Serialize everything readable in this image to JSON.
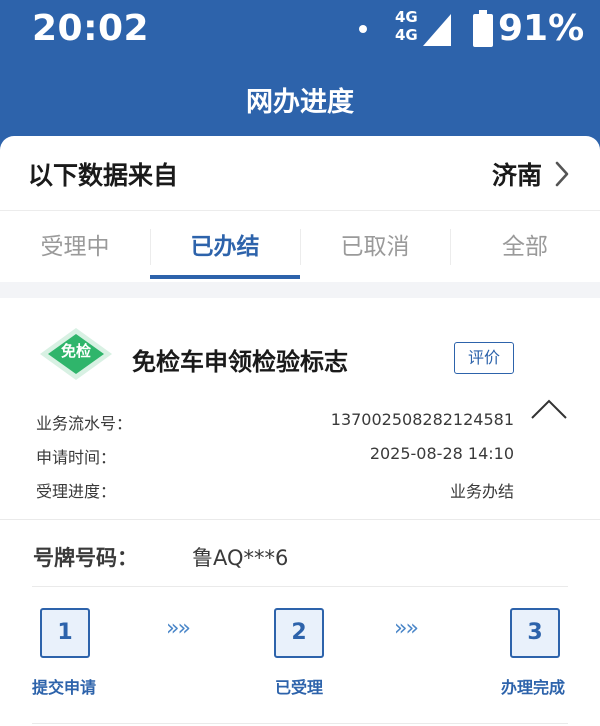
{
  "status_bar": {
    "time": "20:02",
    "network_top": "4G",
    "network_bottom": "4G",
    "battery": "91%"
  },
  "header": {
    "title": "网办进度"
  },
  "source": {
    "label": "以下数据来自",
    "city": "济南"
  },
  "tabs": [
    {
      "label": "受理中",
      "active": false
    },
    {
      "label": "已办结",
      "active": true
    },
    {
      "label": "已取消",
      "active": false
    },
    {
      "label": "全部",
      "active": false
    }
  ],
  "record": {
    "badge": "免检",
    "title": "免检车申领检验标志",
    "rate_label": "评价",
    "fields": [
      {
        "label": "业务流水号：",
        "value": "137002508282124581"
      },
      {
        "label": "申请时间：",
        "value": "2025-08-28 14:10"
      },
      {
        "label": "受理进度：",
        "value": "业务办结"
      }
    ],
    "plate_label": "号牌号码：",
    "plate_value": "鲁AQ***6",
    "steps": [
      {
        "number": "1",
        "label": "提交申请"
      },
      {
        "number": "2",
        "label": "已受理"
      },
      {
        "number": "3",
        "label": "办理完成"
      }
    ],
    "arrow_glyph": "»»"
  },
  "colors": {
    "primary": "#2d63ab",
    "badge_green": "#2fb56b",
    "badge_light": "#d8f1e3"
  }
}
